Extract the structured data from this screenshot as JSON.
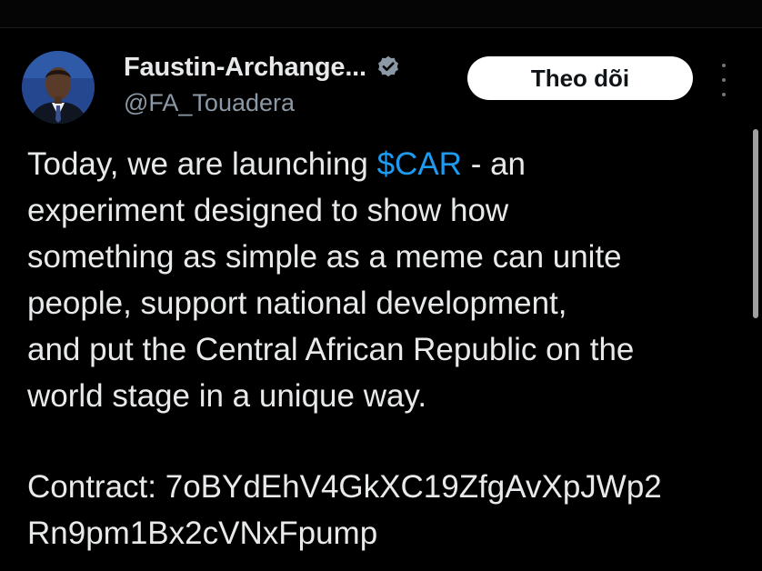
{
  "tweet": {
    "author": {
      "display_name": "Faustin-Archange...",
      "handle": "@FA_Touadera",
      "verified": true,
      "avatar_icon": "avatar-portrait"
    },
    "follow_label": "Theo dõi",
    "more_icon": "more-options-icon",
    "body_lines": [
      {
        "before": "Today, we are launching ",
        "cashtag": "$CAR",
        "after": " - an"
      },
      "experiment designed to show how",
      "something as simple as a meme can unite",
      "people, support national development,",
      "and put the Central African Republic on the",
      "world stage in a unique way."
    ],
    "contract_lines": [
      "Contract: 7oBYdEhV4GkXC19ZfgAvXpJWp2",
      "Rn9pm1Bx2cVNxFpump"
    ]
  },
  "colors": {
    "background": "#000000",
    "text": "#e7e9ea",
    "secondary_text": "#8b98a5",
    "link": "#1d9bf0",
    "follow_button_bg": "#ffffff",
    "follow_button_text": "#0f1419",
    "verified_badge": "#8b98a5"
  }
}
